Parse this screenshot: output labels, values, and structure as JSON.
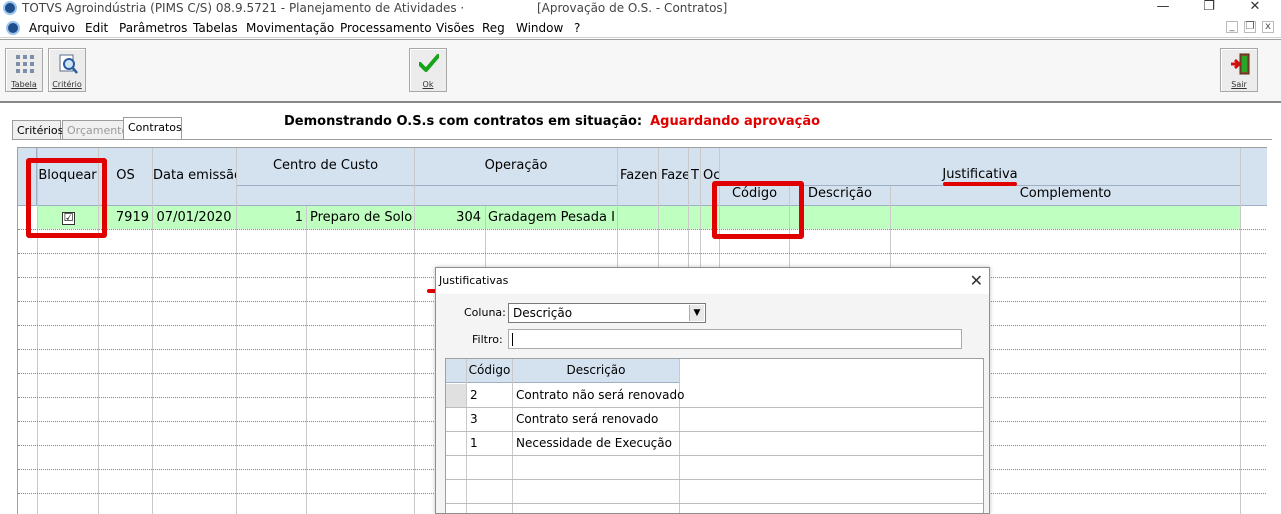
{
  "window": {
    "app_title": "TOTVS Agroindústria (PIMS C/S) 08.9.5721 - Planejamento de Atividades  ·",
    "doc_title": "[Aprovação de O.S. - Contratos]",
    "minimize": "—",
    "restore": "❐",
    "close": "✕"
  },
  "menu": {
    "items": [
      "Arquivo",
      "Edit",
      "Parâmetros",
      "Tabelas",
      "Movimentação",
      "Processamento",
      "Visões",
      "Reg",
      "Window",
      "?"
    ],
    "mdi_min": "_",
    "mdi_restore": "❐",
    "mdi_close": "x"
  },
  "toolbar": {
    "tabela": "Tabela",
    "criterio": "Critério",
    "ok": "Ok",
    "sair": "Sair"
  },
  "tabs": [
    {
      "label": "Critérios",
      "state": "normal"
    },
    {
      "label": "Orçamento",
      "state": "disabled"
    },
    {
      "label": "Contratos",
      "state": "active"
    }
  ],
  "heading": {
    "text": "Demonstrando O.S.s com contratos em situação:",
    "status": "Aguardando aprovação",
    "status_color": "#e00000"
  },
  "grid": {
    "headers": {
      "bloquear": "Bloquear",
      "os": "OS",
      "data_emissao": "Data emissão",
      "centro_custo": "Centro de Custo",
      "operacao": "Operação",
      "fazenda": "Fazend",
      "faze2": "Faze",
      "t": "T",
      "oc": "Oc",
      "justificativa": "Justificativa",
      "codigo": "Código",
      "descricao": "Descrição",
      "complemento": "Complemento"
    },
    "row": {
      "bloquear_checked": "☑",
      "os": "7919",
      "data_emissao": "07/01/2020",
      "centro_codigo": "1",
      "centro_desc": "Preparo de Solo",
      "operacao_codigo": "304",
      "operacao_desc": "Gradagem Pesada I",
      "row_color": "#bfffbf"
    }
  },
  "dialog": {
    "title": "Justificativas",
    "close": "✕",
    "coluna_label": "Coluna:",
    "coluna_value": "Descrição",
    "filtro_label": "Filtro:",
    "filtro_value": "",
    "headers": {
      "codigo": "Código",
      "descricao": "Descrição"
    },
    "rows": [
      {
        "codigo": "2",
        "descricao": "Contrato não será renovado"
      },
      {
        "codigo": "3",
        "descricao": "Contrato será renovado"
      },
      {
        "codigo": "1",
        "descricao": "Necessidade de Execução"
      }
    ]
  }
}
